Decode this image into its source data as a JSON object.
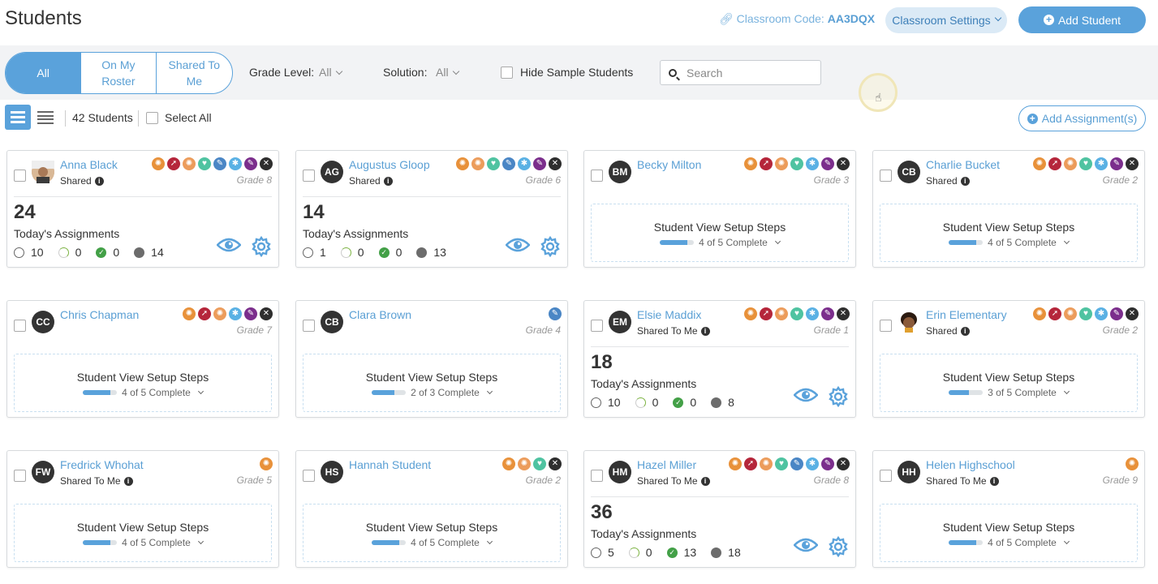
{
  "header": {
    "title": "Students",
    "classroom_code_label": "Classroom Code:",
    "classroom_code": "AA3DQX",
    "settings_label": "Classroom Settings",
    "add_student_label": "Add Student"
  },
  "filters": {
    "segments": [
      "All",
      "On My Roster",
      "Shared To Me"
    ],
    "active_segment": "All",
    "grade_label": "Grade Level:",
    "grade_value": "All",
    "solution_label": "Solution:",
    "solution_value": "All",
    "hide_sample_label": "Hide Sample Students",
    "search_placeholder": "Search"
  },
  "toolbar": {
    "count_label": "42 Students",
    "select_all_label": "Select All",
    "add_assignment_label": "Add Assignment(s)"
  },
  "icon_colors": {
    "orange": "#e8913a",
    "crimson": "#b5263b",
    "peach": "#ec9c5b",
    "teal": "#4fc3a1",
    "blue": "#4a86c5",
    "sky": "#5ab1e4",
    "purple": "#7b2e8c",
    "dark": "#2e2e2e"
  },
  "students": [
    {
      "name": "Anna Black",
      "initials": "",
      "avatar": "photo",
      "shared": "Shared",
      "grade": "Grade 8",
      "icons": [
        "orange",
        "crimson",
        "peach",
        "teal",
        "blue",
        "sky",
        "purple",
        "dark"
      ],
      "mode": "assign",
      "today": "24",
      "today_label": "Today's Assignments",
      "s_open": "10",
      "s_progress": "0",
      "s_done": "0",
      "s_other": "14"
    },
    {
      "name": "Augustus Gloop",
      "initials": "AG",
      "avatar": "initials",
      "shared": "Shared",
      "grade": "Grade 6",
      "icons": [
        "orange",
        "peach",
        "teal",
        "blue",
        "sky",
        "purple",
        "dark"
      ],
      "mode": "assign",
      "today": "14",
      "today_label": "Today's Assignments",
      "s_open": "1",
      "s_progress": "0",
      "s_done": "0",
      "s_other": "13"
    },
    {
      "name": "Becky Milton",
      "initials": "BM",
      "avatar": "initials",
      "shared": "",
      "grade": "Grade 3",
      "icons": [
        "orange",
        "crimson",
        "peach",
        "teal",
        "sky",
        "purple",
        "dark"
      ],
      "mode": "setup",
      "setup_title": "Student View Setup Steps",
      "setup_progress": "4 of 5 Complete",
      "setup_fill": 0.8
    },
    {
      "name": "Charlie Bucket",
      "initials": "CB",
      "avatar": "initials",
      "shared": "Shared",
      "grade": "Grade 2",
      "icons": [
        "orange",
        "crimson",
        "peach",
        "teal",
        "sky",
        "purple",
        "dark"
      ],
      "mode": "setup",
      "setup_title": "Student View Setup Steps",
      "setup_progress": "4 of 5 Complete",
      "setup_fill": 0.8
    },
    {
      "name": "Chris Chapman",
      "initials": "CC",
      "avatar": "initials",
      "shared": "",
      "grade": "Grade 7",
      "icons": [
        "orange",
        "crimson",
        "peach",
        "sky",
        "purple",
        "dark"
      ],
      "mode": "setup",
      "setup_title": "Student View Setup Steps",
      "setup_progress": "4 of 5 Complete",
      "setup_fill": 0.8
    },
    {
      "name": "Clara Brown",
      "initials": "CB",
      "avatar": "initials",
      "shared": "",
      "grade": "Grade 4",
      "icons": [
        "blue"
      ],
      "mode": "setup",
      "setup_title": "Student View Setup Steps",
      "setup_progress": "2 of 3 Complete",
      "setup_fill": 0.67
    },
    {
      "name": "Elsie Maddix",
      "initials": "EM",
      "avatar": "initials",
      "shared": "Shared To Me",
      "grade": "Grade 1",
      "icons": [
        "orange",
        "crimson",
        "peach",
        "teal",
        "sky",
        "purple",
        "dark"
      ],
      "mode": "assign",
      "today": "18",
      "today_label": "Today's Assignments",
      "s_open": "10",
      "s_progress": "0",
      "s_done": "0",
      "s_other": "8"
    },
    {
      "name": "Erin Elementary",
      "initials": "",
      "avatar": "cartoon",
      "shared": "Shared",
      "grade": "Grade 2",
      "icons": [
        "orange",
        "crimson",
        "peach",
        "teal",
        "sky",
        "purple",
        "dark"
      ],
      "mode": "setup",
      "setup_title": "Student View Setup Steps",
      "setup_progress": "3 of 5 Complete",
      "setup_fill": 0.6
    },
    {
      "name": "Fredrick Whohat",
      "initials": "FW",
      "avatar": "initials",
      "shared": "Shared To Me",
      "grade": "Grade 5",
      "icons": [
        "orange"
      ],
      "mode": "setup",
      "setup_title": "Student View Setup Steps",
      "setup_progress": "4 of 5 Complete",
      "setup_fill": 0.8
    },
    {
      "name": "Hannah Student",
      "initials": "HS",
      "avatar": "initials",
      "shared": "",
      "grade": "Grade 2",
      "icons": [
        "orange",
        "peach",
        "teal",
        "dark"
      ],
      "mode": "setup",
      "setup_title": "Student View Setup Steps",
      "setup_progress": "4 of 5 Complete",
      "setup_fill": 0.8
    },
    {
      "name": "Hazel Miller",
      "initials": "HM",
      "avatar": "initials",
      "shared": "Shared To Me",
      "grade": "Grade 8",
      "icons": [
        "orange",
        "crimson",
        "peach",
        "teal",
        "blue",
        "sky",
        "purple",
        "dark"
      ],
      "mode": "assign",
      "today": "36",
      "today_label": "Today's Assignments",
      "s_open": "5",
      "s_progress": "0",
      "s_done": "13",
      "s_other": "18"
    },
    {
      "name": "Helen Highschool",
      "initials": "HH",
      "avatar": "initials",
      "shared": "Shared To Me",
      "grade": "Grade 9",
      "icons": [
        "orange"
      ],
      "mode": "setup",
      "setup_title": "Student View Setup Steps",
      "setup_progress": "4 of 5 Complete",
      "setup_fill": 0.8
    }
  ]
}
